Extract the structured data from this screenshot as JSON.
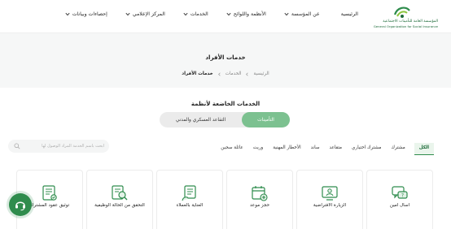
{
  "header": {
    "logo_ar": "المؤسسة العامة للتأمينات الاجتماعية",
    "logo_en": "General Organization for Social Insurance",
    "nav": [
      {
        "label": "الرئيسية",
        "dropdown": false
      },
      {
        "label": "عن المؤسسة",
        "dropdown": true
      },
      {
        "label": "الأنظمة واللوائح",
        "dropdown": true
      },
      {
        "label": "الخدمات",
        "dropdown": true
      },
      {
        "label": "المركز الإعلامي",
        "dropdown": true
      },
      {
        "label": "إحصاءات وبيانات",
        "dropdown": true
      }
    ]
  },
  "hero": {
    "title": "خدمات الأفراد",
    "breadcrumb": [
      "الرئيسية",
      "الخدمات",
      "خدمات الأفراد"
    ]
  },
  "content": {
    "section_title": "الخدمات الخاضعة لأنظمة",
    "toggle": {
      "active": "التأمينات",
      "inactive": "التقاعد العسكري والمدني"
    },
    "search_placeholder": "ابحث باسم الخدمة المراد الوصول لها",
    "filters": [
      "الكل",
      "مشترك",
      "مشترك اختياري",
      "متقاعد",
      "ساند",
      "الأخطار المهنية",
      "وريث",
      "عائلة سجين"
    ],
    "active_filter": "الكل",
    "cards": [
      {
        "label": "اسأل أمين",
        "icon": "chat-question-icon"
      },
      {
        "label": "الزيارة الافتراضية",
        "icon": "video-call-icon"
      },
      {
        "label": "حجز موعد",
        "icon": "calendar-add-icon"
      },
      {
        "label": "العناية بالعملاء",
        "icon": "customer-care-icon"
      },
      {
        "label": "التحقق من الحالة الوظيفية",
        "icon": "search-document-icon"
      },
      {
        "label": "توثيق عقود المشترك",
        "icon": "contract-icon"
      }
    ]
  },
  "colors": {
    "primary": "#2f8c4d",
    "toggle_active": "#7cc190",
    "background": "#f6f7f7"
  }
}
